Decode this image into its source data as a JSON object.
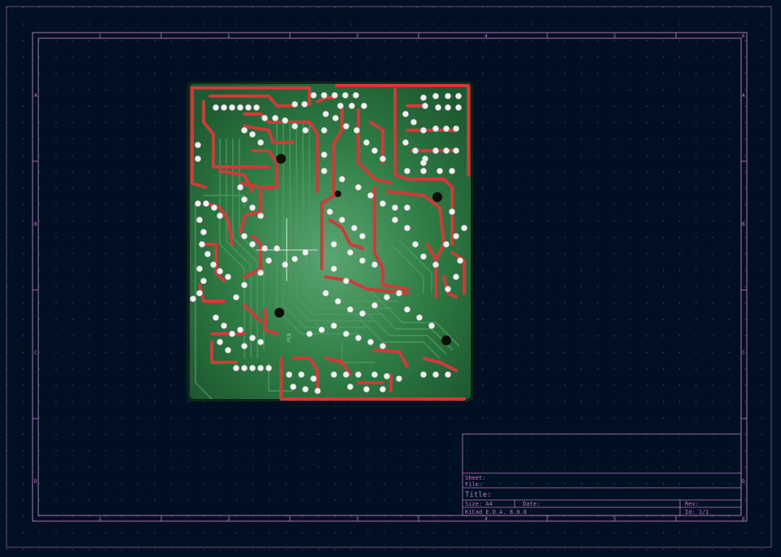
{
  "app": {
    "name": "KiCad PCB canvas"
  },
  "colors": {
    "background": "#001023",
    "grid": "#5a6b80",
    "frame": "#c37ac0",
    "board_green": "#2f7d45",
    "trace_red": "#cf3b39",
    "pad_white": "#f2f2f2",
    "cursor": "#ffffff"
  },
  "frame": {
    "column_labels": [
      "1",
      "2",
      "3",
      "4",
      "5",
      "6"
    ],
    "row_labels": [
      "A",
      "B",
      "C",
      "D"
    ]
  },
  "title_block": {
    "sheet_label": "Sheet:",
    "file_label": "File:",
    "title_label": "Title:",
    "size_label": "Size: A4",
    "date_label": "Date:",
    "rev_label": "Rev:",
    "generator": "KiCad E.D.A. 8.0.8",
    "id_label": "Id: 1/1"
  },
  "board": {
    "silkscreen_label": "PCB"
  }
}
